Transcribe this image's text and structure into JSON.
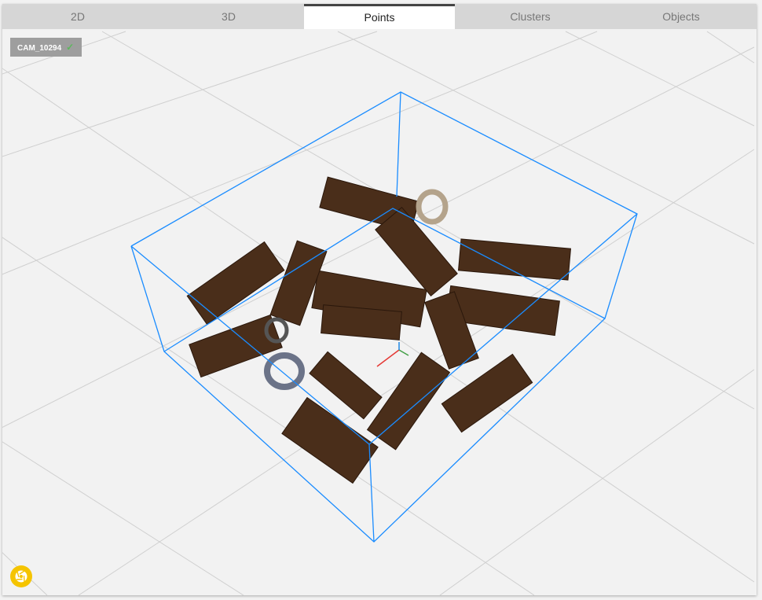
{
  "tabs": [
    {
      "label": "2D"
    },
    {
      "label": "3D"
    },
    {
      "label": "Points",
      "active": true
    },
    {
      "label": "Clusters"
    },
    {
      "label": "Objects"
    }
  ],
  "camera": {
    "name": "CAM_10294",
    "status_icon": "check-icon"
  },
  "snapshot_icon": "camera-shutter-icon",
  "colors": {
    "bbox": "#1a8cff",
    "accent": "#f5c400",
    "grid": "#cfcfcf",
    "points": "#4a2e1a"
  }
}
